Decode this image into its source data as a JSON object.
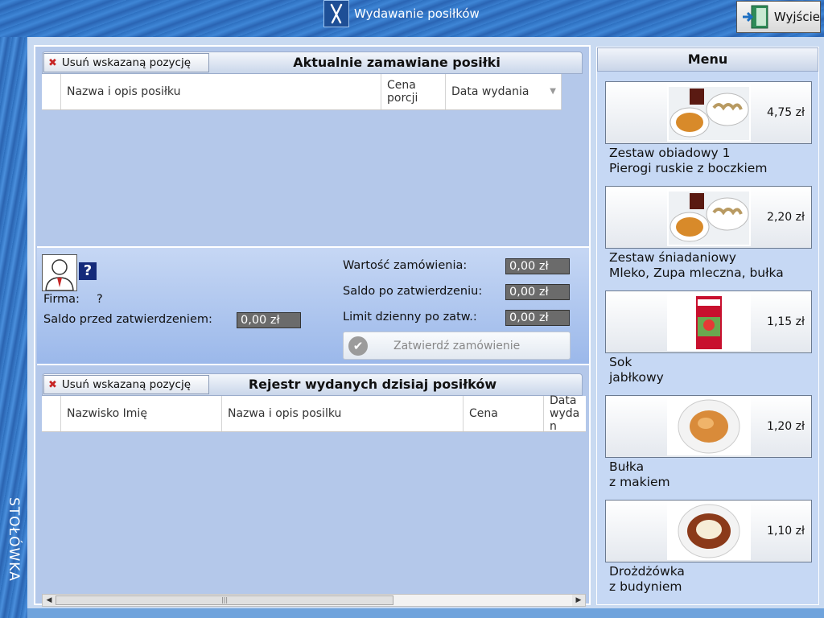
{
  "window": {
    "title": "Wydawanie posiłków",
    "exit_label": "Wyjście",
    "side_label": "STOŁÓWKA"
  },
  "current_orders": {
    "delete_label": "Usuń wskazaną pozycję",
    "title": "Aktualnie zamawiane posiłki",
    "columns": [
      "Nazwa i opis posiłku",
      "Cena porcji",
      "Data wydania"
    ]
  },
  "order": {
    "firma_label": "Firma:",
    "firma_value": "?",
    "customer_mark": "?",
    "saldo_przed_label": "Saldo przed zatwierdzeniem:",
    "saldo_przed_value": "0,00 zł",
    "wartosc_label": "Wartość zamówienia:",
    "wartosc_value": "0,00 zł",
    "saldo_po_label": "Saldo po zatwierdzeniu:",
    "saldo_po_value": "0,00 zł",
    "limit_label": "Limit dzienny po zatw.:",
    "limit_value": "0,00 zł",
    "confirm_label": "Zatwierdź zamówienie"
  },
  "register": {
    "delete_label": "Usuń wskazaną pozycję",
    "title": "Rejestr wydanych dzisiaj posiłków",
    "columns": [
      "Nazwisko Imię",
      "Nazwa i opis posilku",
      "Cena",
      "Data wydan"
    ]
  },
  "menu": {
    "title": "Menu",
    "items": [
      {
        "price": "4,75 zł",
        "line1": "Zestaw obiadowy 1",
        "line2": "Pierogi ruskie z boczkiem",
        "icon": "tray-meal-icon"
      },
      {
        "price": "2,20 zł",
        "line1": "Zestaw śniadaniowy",
        "line2": "Mleko, Zupa mleczna, bułka",
        "icon": "tray-meal-icon"
      },
      {
        "price": "1,15 zł",
        "line1": "Sok",
        "line2": "jabłkowy",
        "icon": "juice-carton-icon"
      },
      {
        "price": "1,20 zł",
        "line1": "Bułka",
        "line2": "z makiem",
        "icon": "bun-icon"
      },
      {
        "price": "1,10 zł",
        "line1": "Drożdżówka",
        "line2": "z budyniem",
        "icon": "sweet-roll-icon"
      }
    ]
  },
  "colors": {
    "panel_bg": "#b4c8ea",
    "value_box": "#6b6b6b",
    "accent_blue": "#2f6fb0"
  }
}
